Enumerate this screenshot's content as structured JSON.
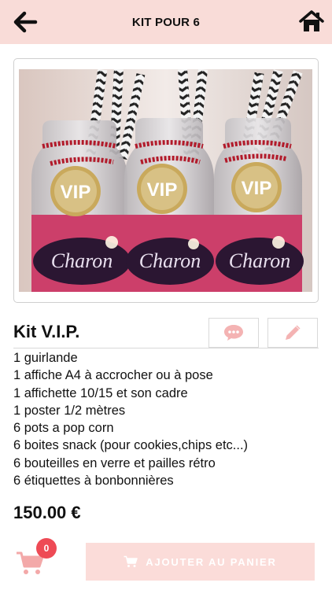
{
  "header": {
    "title": "KIT POUR 6"
  },
  "product": {
    "title": "Kit V.I.P.",
    "photo_text": {
      "vip": "VIP",
      "name": "Charon"
    },
    "description": [
      "1 guirlande",
      "1 affiche A4 à accrocher ou à pose",
      "1 affichette 10/15 et son cadre",
      "1 poster 1/2 mètres",
      "6 pots a pop corn",
      "6 boites snack (pour cookies,chips etc...)",
      "6 bouteilles en verre et pailles rétro",
      "6 étiquettes à bonbonnières"
    ],
    "price": "150.00 €"
  },
  "cart": {
    "count": "0",
    "add_label": "AJOUTER AU PANIER"
  },
  "colors": {
    "header_bg": "#f9dcd8",
    "accent_pink": "#f3a9a9",
    "badge": "#ee4a55",
    "button_bg": "#fbdcd9"
  },
  "icons": {
    "back": "arrow-left-icon",
    "home": "home-icon",
    "comment": "speech-bubble-icon",
    "edit": "pencil-icon",
    "cart": "shopping-cart-icon"
  }
}
